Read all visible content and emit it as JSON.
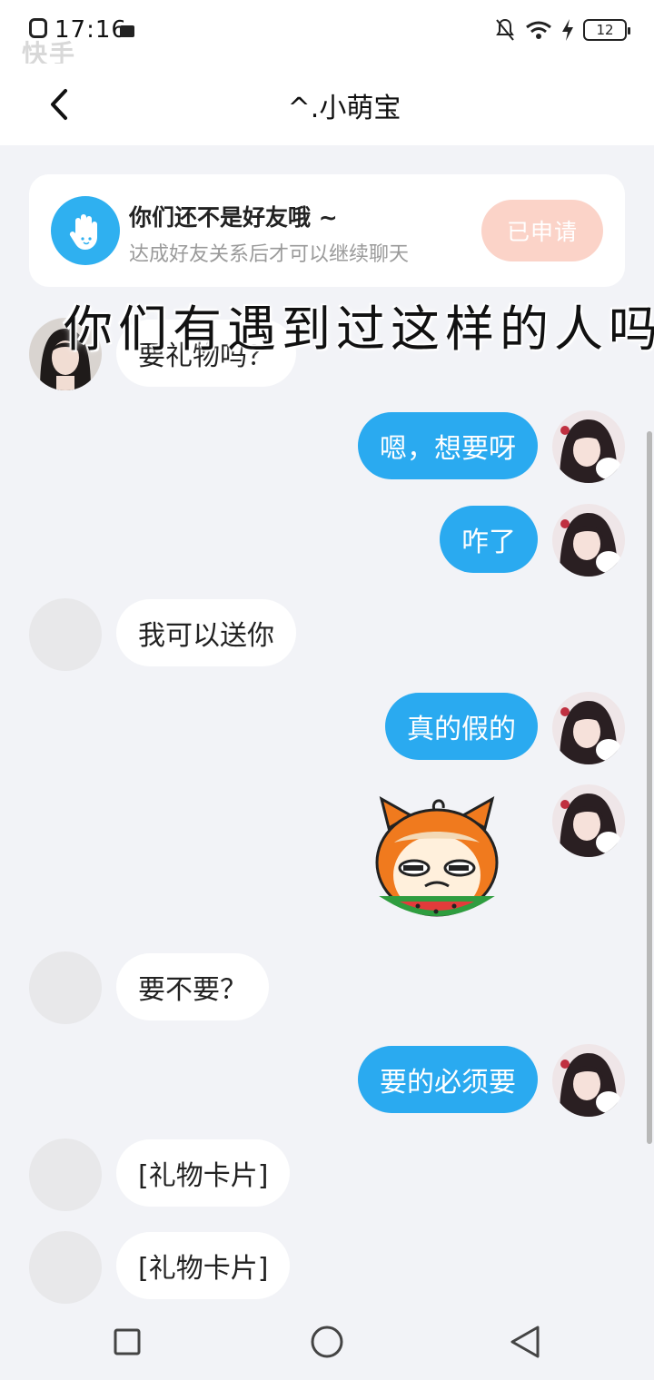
{
  "status_bar": {
    "time": "17:16",
    "watermark": "快手",
    "battery": "12"
  },
  "header": {
    "title": "^.小萌宝"
  },
  "notice": {
    "title": "你们还不是好友哦 ~",
    "subtitle": "达成好友关系后才可以继续聊天",
    "button_label": "已申请"
  },
  "overlay_caption": "你们有遇到过这样的人吗",
  "messages": [
    {
      "side": "left",
      "text": "要礼物吗？"
    },
    {
      "side": "right",
      "text": "嗯，想要呀"
    },
    {
      "side": "right",
      "text": "咋了"
    },
    {
      "side": "left",
      "text": "我可以送你"
    },
    {
      "side": "right",
      "text": "真的假的"
    },
    {
      "side": "right",
      "sticker": "melon-eating-cat-sticker"
    },
    {
      "side": "left",
      "text": "要不要？"
    },
    {
      "side": "right",
      "text": "要的必须要"
    },
    {
      "side": "left",
      "text": "[礼物卡片]"
    },
    {
      "side": "left",
      "text": "[礼物卡片]"
    }
  ],
  "colors": {
    "accent": "#2aaaf0",
    "applied_button": "#fbd3c8",
    "background": "#f2f3f7"
  }
}
